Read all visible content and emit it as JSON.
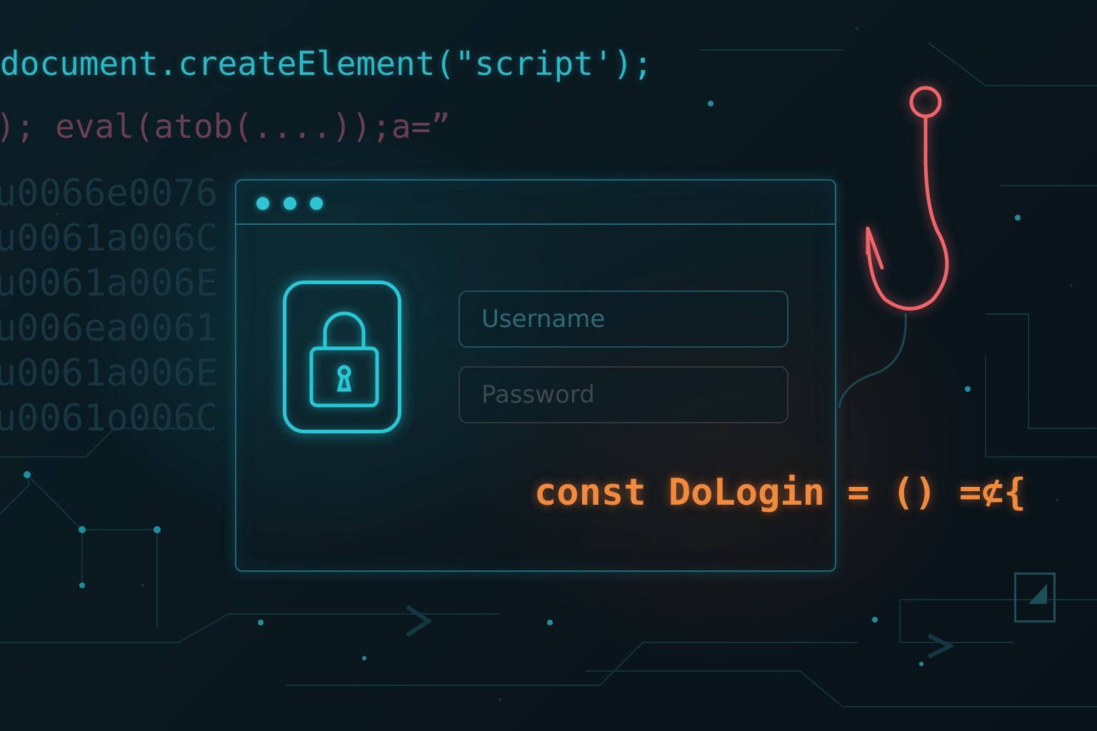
{
  "background_code": {
    "line1": "document.createElement(\"script');",
    "line2": "); eval(atob(....));a=”",
    "hex_lines": [
      "u0066e0076",
      "u0061a006C",
      "u0061a006E",
      "u006ea0061",
      "u0061a006E",
      "u0061o006C"
    ]
  },
  "login_window": {
    "username_placeholder": "Username",
    "password_placeholder": "Password"
  },
  "code_snippet": "const DoLogin = () =⊄{",
  "colors": {
    "background": "#0a1920",
    "cyan_accent": "#28c8d6",
    "hook_red": "#f0646a",
    "code_orange": "#f08a3e"
  },
  "icons": [
    "lock-icon",
    "fishhook-icon"
  ]
}
